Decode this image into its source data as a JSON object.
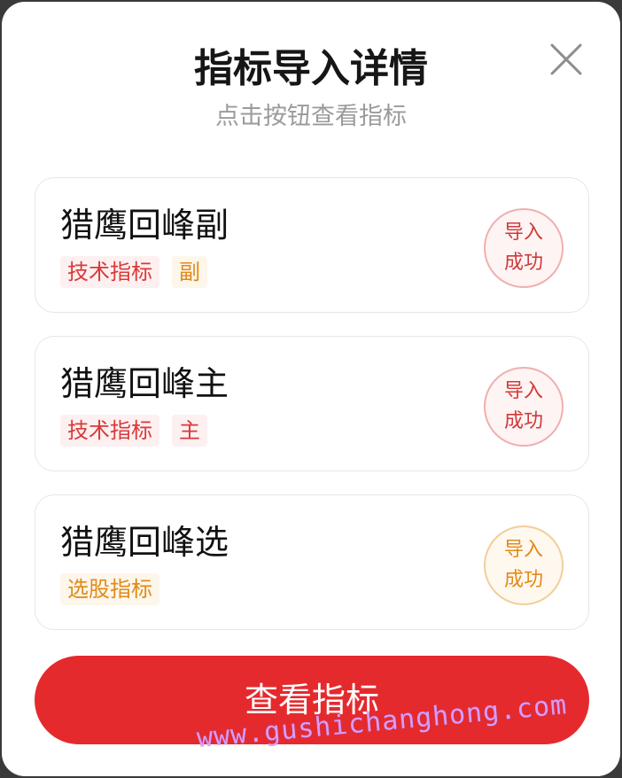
{
  "dialog": {
    "title": "指标导入详情",
    "subtitle": "点击按钮查看指标",
    "close_icon": "close-icon"
  },
  "items": [
    {
      "name": "猎鹰回峰副",
      "tags": [
        "技术指标",
        "副"
      ],
      "status": [
        "导入",
        "成功"
      ]
    },
    {
      "name": "猎鹰回峰主",
      "tags": [
        "技术指标",
        "主"
      ],
      "status": [
        "导入",
        "成功"
      ]
    },
    {
      "name": "猎鹰回峰选",
      "tags": [
        "选股指标"
      ],
      "status": [
        "导入",
        "成功"
      ]
    }
  ],
  "button": {
    "label": "查看指标"
  },
  "watermark": "www.gushichanghong.com",
  "colors": {
    "accent_red": "#e52a2d",
    "tag_red": "#d93a3a",
    "tag_orange": "#e08a1a",
    "watermark": "#d9a3ff"
  }
}
